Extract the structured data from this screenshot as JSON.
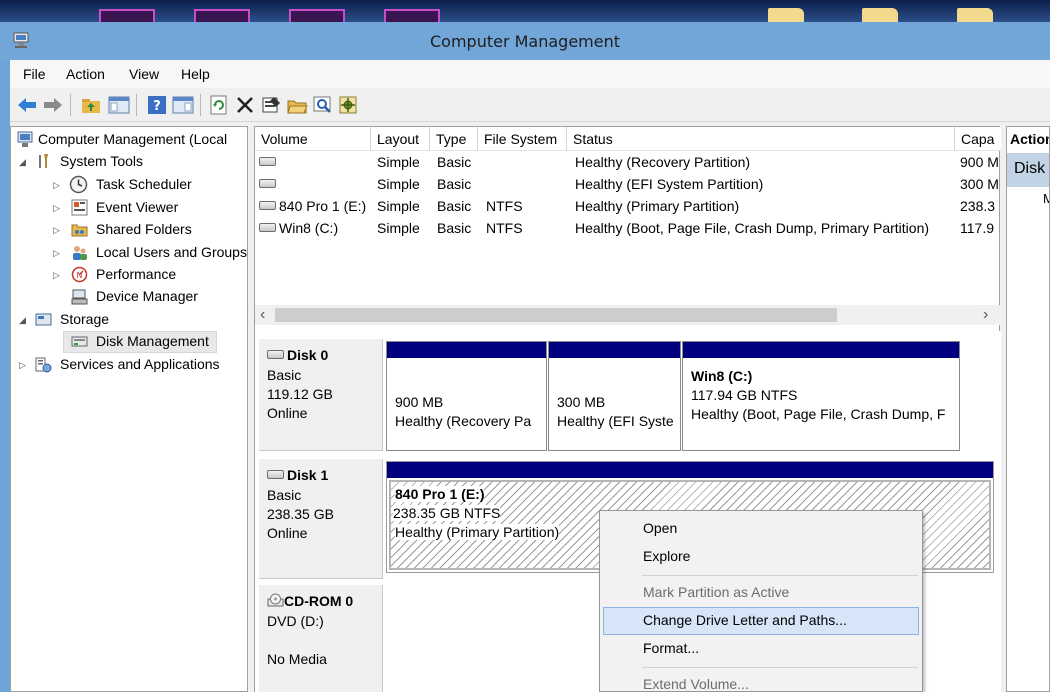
{
  "window": {
    "title": "Computer Management"
  },
  "menu": [
    "File",
    "Action",
    "View",
    "Help"
  ],
  "toolbar": {
    "icons": [
      "back-icon",
      "forward-icon",
      "up-folder-icon",
      "show-hide-tree-icon",
      "help-icon",
      "show-hide-action-pane-icon",
      "refresh-icon",
      "delete-icon",
      "properties-icon",
      "open-folder-icon",
      "search-icon",
      "settings-icon"
    ]
  },
  "tree": {
    "root": "Computer Management (Local",
    "system_tools": "System Tools",
    "task_scheduler": "Task Scheduler",
    "event_viewer": "Event Viewer",
    "shared_folders": "Shared Folders",
    "local_users": "Local Users and Groups",
    "performance": "Performance",
    "device_manager": "Device Manager",
    "storage": "Storage",
    "disk_management": "Disk Management",
    "services": "Services and Applications"
  },
  "volume_list": {
    "columns": [
      "Volume",
      "Layout",
      "Type",
      "File System",
      "Status",
      "Capa"
    ],
    "rows": [
      {
        "volume": "",
        "layout": "Simple",
        "type": "Basic",
        "fs": "",
        "status": "Healthy (Recovery Partition)",
        "capacity": "900 M"
      },
      {
        "volume": "",
        "layout": "Simple",
        "type": "Basic",
        "fs": "",
        "status": "Healthy (EFI System Partition)",
        "capacity": "300 M"
      },
      {
        "volume": "840 Pro 1 (E:)",
        "layout": "Simple",
        "type": "Basic",
        "fs": "NTFS",
        "status": "Healthy (Primary Partition)",
        "capacity": "238.3"
      },
      {
        "volume": "Win8 (C:)",
        "layout": "Simple",
        "type": "Basic",
        "fs": "NTFS",
        "status": "Healthy (Boot, Page File, Crash Dump, Primary Partition)",
        "capacity": "117.9"
      }
    ]
  },
  "disks": [
    {
      "name": "Disk 0",
      "type": "Basic",
      "size": "119.12 GB",
      "state": "Online",
      "partitions": [
        {
          "title": "",
          "size": "900 MB",
          "status": "Healthy (Recovery Pa"
        },
        {
          "title": "",
          "size": "300 MB",
          "status": "Healthy (EFI Syste"
        },
        {
          "title": "Win8  (C:)",
          "size": "117.94 GB NTFS",
          "status": "Healthy (Boot, Page File, Crash Dump, F"
        }
      ]
    },
    {
      "name": "Disk 1",
      "type": "Basic",
      "size": "238.35 GB",
      "state": "Online",
      "partitions": [
        {
          "title": "840 Pro 1  (E:)",
          "size": "238.35 GB NTFS",
          "status": "Healthy (Primary Partition)"
        }
      ]
    },
    {
      "name": "CD-ROM 0",
      "type": "DVD (D:)",
      "size": "",
      "state": "No Media",
      "partitions": []
    }
  ],
  "actions": {
    "header": "Action",
    "subheader": "Disk",
    "more": "M"
  },
  "context_menu": {
    "open": "Open",
    "explore": "Explore",
    "mark_active": "Mark Partition as Active",
    "change_letter": "Change Drive Letter and Paths...",
    "format": "Format...",
    "extend": "Extend Volume..."
  }
}
